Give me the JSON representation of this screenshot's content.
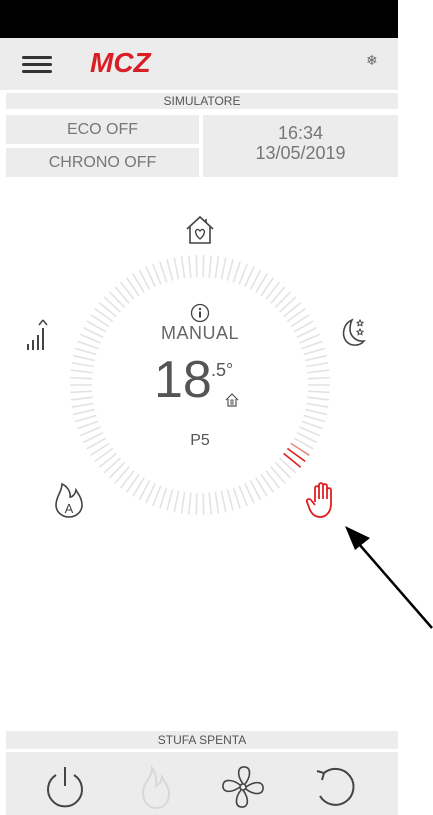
{
  "header": {
    "brand": "MCZ",
    "menu_icon": "hamburger-menu-icon",
    "settings_icon": "snowflake-icon"
  },
  "simulator_label": "SIMULATORE",
  "eco_status": "ECO OFF",
  "chrono_status": "CHRONO OFF",
  "time": "16:34",
  "date": "13/05/2019",
  "dial": {
    "mode": "MANUAL",
    "temp_whole": "18",
    "temp_decimal": ".5°",
    "power_level": "P5",
    "info_icon": "info-icon",
    "home_temp_icon": "house-thermometer-icon"
  },
  "modes": {
    "comfort": "house-heart-icon",
    "night": "moon-stars-icon",
    "manual": "hand-icon",
    "auto": "flame-a-icon",
    "power": "signal-bars-icon"
  },
  "stove_status": "STUFA SPENTA",
  "bottom_buttons": [
    "power-icon",
    "flame-icon",
    "fan-icon",
    "reset-icon"
  ],
  "colors": {
    "accent": "#e02020",
    "panel": "#ececec"
  }
}
